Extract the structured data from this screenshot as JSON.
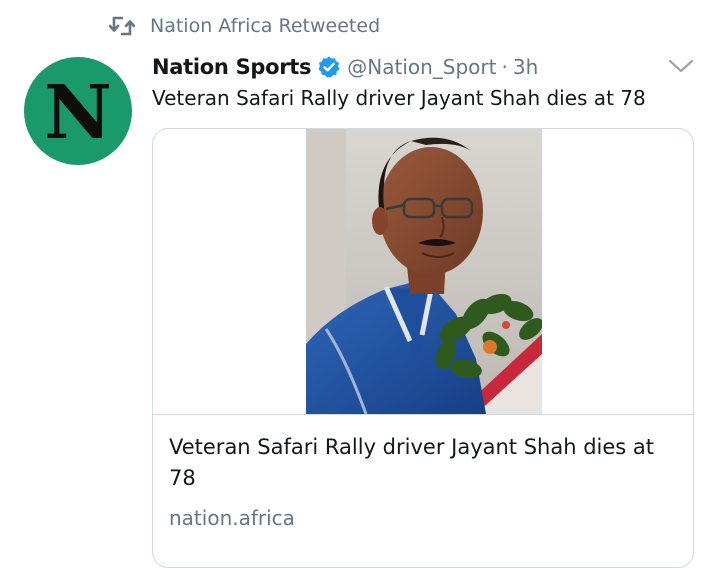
{
  "retweet": {
    "icon": "retweet-icon",
    "text": "Nation Africa Retweeted"
  },
  "avatar": {
    "letter": "N",
    "color": "#1a9a6a"
  },
  "tweet": {
    "author_name": "Nation Sports",
    "verified_icon": "verified-badge-icon",
    "handle": "@Nation_Sport",
    "separator": "·",
    "time": "3h",
    "text": "Veteran Safari Rally driver Jayant Shah dies at 78",
    "menu_icon": "chevron-down-icon"
  },
  "card": {
    "image_icon": "portrait-photo",
    "title": "Veteran Safari Rally driver Jayant Shah dies at 78",
    "domain": "nation.africa"
  },
  "colors": {
    "accent": "#1d9bf0",
    "secondary_text": "#657786",
    "border": "#cfd9de"
  }
}
